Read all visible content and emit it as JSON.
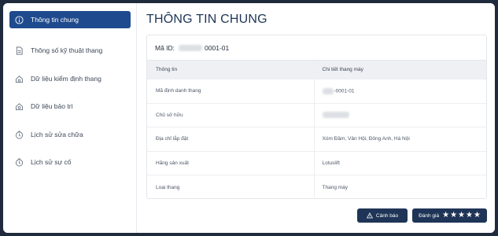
{
  "sidebar": {
    "items": [
      {
        "label": "Thông tin chung",
        "icon": "info-icon",
        "active": true
      },
      {
        "label": "Thông số kỹ thuật thang",
        "icon": "document-icon",
        "active": false
      },
      {
        "label": "Dữ liệu kiểm định thang",
        "icon": "house-icon",
        "active": false
      },
      {
        "label": "Dữ liệu bảo trì",
        "icon": "house-gear-icon",
        "active": false
      },
      {
        "label": "Lịch sử sửa chữa",
        "icon": "clock-icon",
        "active": false
      },
      {
        "label": "Lịch sử sự cố",
        "icon": "clock-icon",
        "active": false
      }
    ]
  },
  "main": {
    "title": "THÔNG TIN CHUNG",
    "id_label": "Mã ID:",
    "id_value": "0001-01",
    "table": {
      "headers": [
        "Thông tin",
        "Chi tiết thang máy"
      ],
      "rows": [
        {
          "label": "Mã định danh thang",
          "value": "-0001-01"
        },
        {
          "label": "Chủ sở hữu",
          "value": ""
        },
        {
          "label": "Địa chỉ lắp đặt",
          "value": "Xóm Đầm, Vân Hội, Đông Anh, Hà Nội"
        },
        {
          "label": "Hãng sản xuất",
          "value": "Lotuslift"
        },
        {
          "label": "Loại thang",
          "value": "Thang máy"
        }
      ]
    }
  },
  "actions": {
    "warning_label": "Cảnh báo",
    "rating_label": "Đánh giá",
    "rating_stars": 5
  },
  "colors": {
    "accent": "#1f4b8e",
    "button": "#1f3557",
    "background": "#1f2b3d"
  }
}
